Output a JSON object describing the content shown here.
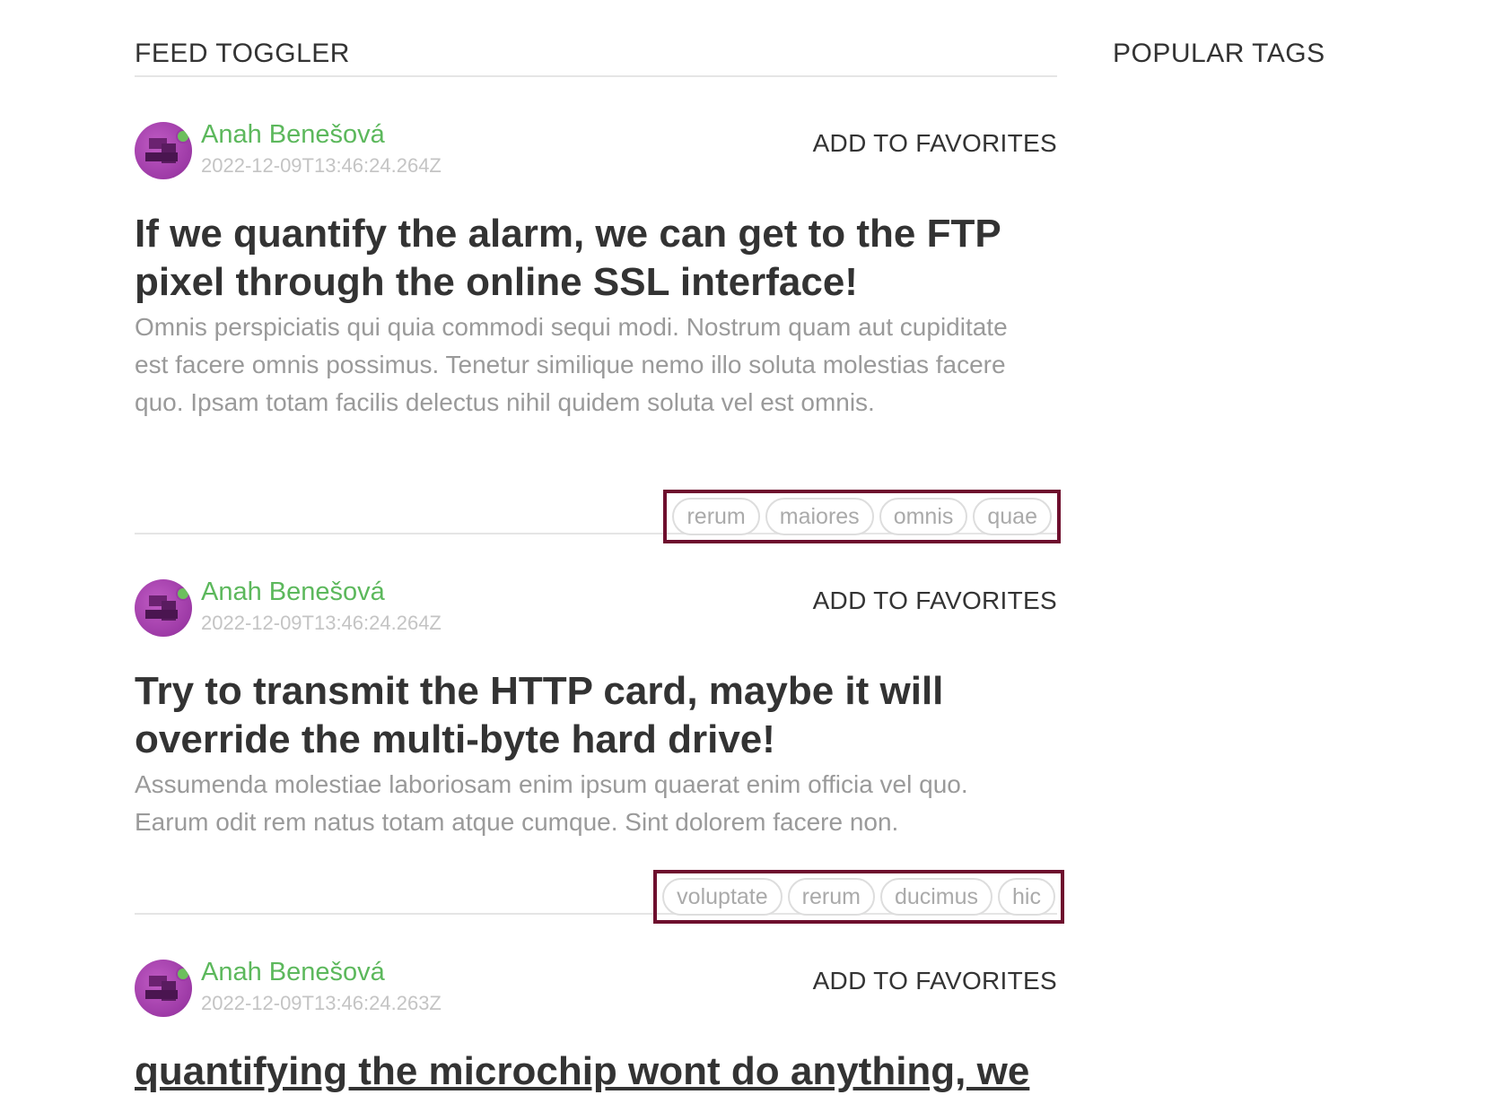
{
  "feed": {
    "toggler_title": "FEED TOGGLER"
  },
  "sidebar": {
    "title": "POPULAR TAGS"
  },
  "articles": [
    {
      "author": "Anah Benešová",
      "date": "2022-12-09T13:46:24.264Z",
      "favorite_label": "ADD TO FAVORITES",
      "title": "If we quantify the alarm, we can get to the FTP pixel through the online SSL interface!",
      "description": "Omnis perspiciatis qui quia commodi sequi modi. Nostrum quam aut cupiditate est facere omnis possimus. Tenetur similique nemo illo soluta molestias facere quo. Ipsam totam facilis delectus nihil quidem soluta vel est omnis.",
      "tags": [
        "rerum",
        "maiores",
        "omnis",
        "quae"
      ]
    },
    {
      "author": "Anah Benešová",
      "date": "2022-12-09T13:46:24.264Z",
      "favorite_label": "ADD TO FAVORITES",
      "title": "Try to transmit the HTTP card, maybe it will override the multi-byte hard drive!",
      "description": "Assumenda molestiae laboriosam enim ipsum quaerat enim officia vel quo. Earum odit rem natus totam atque cumque. Sint dolorem facere non.",
      "tags": [
        "voluptate",
        "rerum",
        "ducimus",
        "hic"
      ]
    },
    {
      "author": "Anah Benešová",
      "date": "2022-12-09T13:46:24.263Z",
      "favorite_label": "ADD TO FAVORITES",
      "title": "quantifying the microchip wont do anything, we"
    }
  ],
  "colors": {
    "author": "#5cb85c",
    "highlight_border": "#6e0f2e",
    "text": "#333333",
    "muted": "#9a9a9a"
  },
  "icons": {
    "avatar": "avatar-image",
    "online": "online-indicator-icon"
  }
}
